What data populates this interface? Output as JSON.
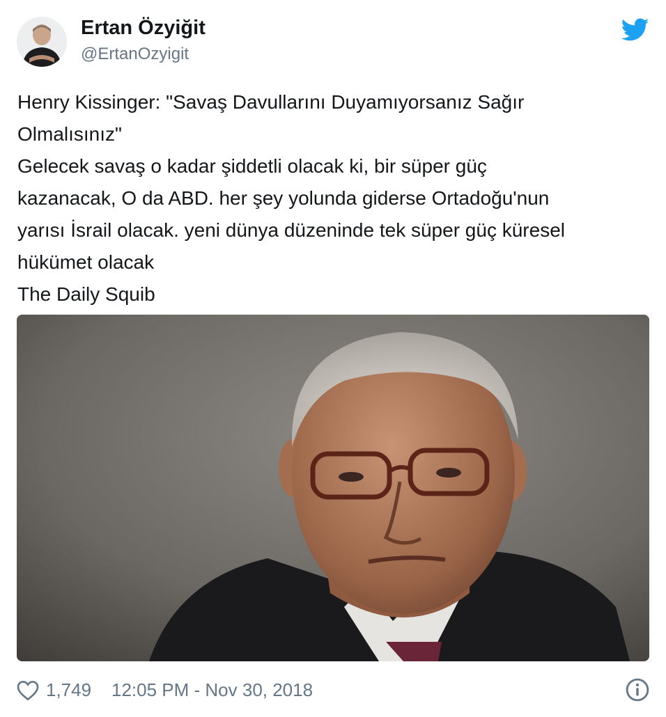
{
  "author": {
    "display_name": "Ertan Özyiğit",
    "handle": "@ErtanOzyigit",
    "avatar_icon": "user-avatar"
  },
  "brand": {
    "logo_icon": "twitter-bird-icon",
    "accent_color": "#1da1f2"
  },
  "tweet": {
    "lines": [
      "Henry Kissinger: \"Savaş Davullarını Duyamıyorsanız Sağır",
      "Olmalısınız\"",
      "Gelecek savaş o kadar şiddetli olacak ki, bir süper güç",
      "kazanacak, O da ABD. her şey yolunda giderse Ortadoğu'nun",
      "yarısı İsrail olacak. yeni dünya düzeninde tek süper güç küresel",
      "hükümet olacak",
      "The Daily Squib"
    ]
  },
  "footer": {
    "like_icon": "heart-icon",
    "like_count": "1,749",
    "timestamp": "12:05 PM - Nov 30, 2018",
    "info_icon": "info-icon"
  }
}
